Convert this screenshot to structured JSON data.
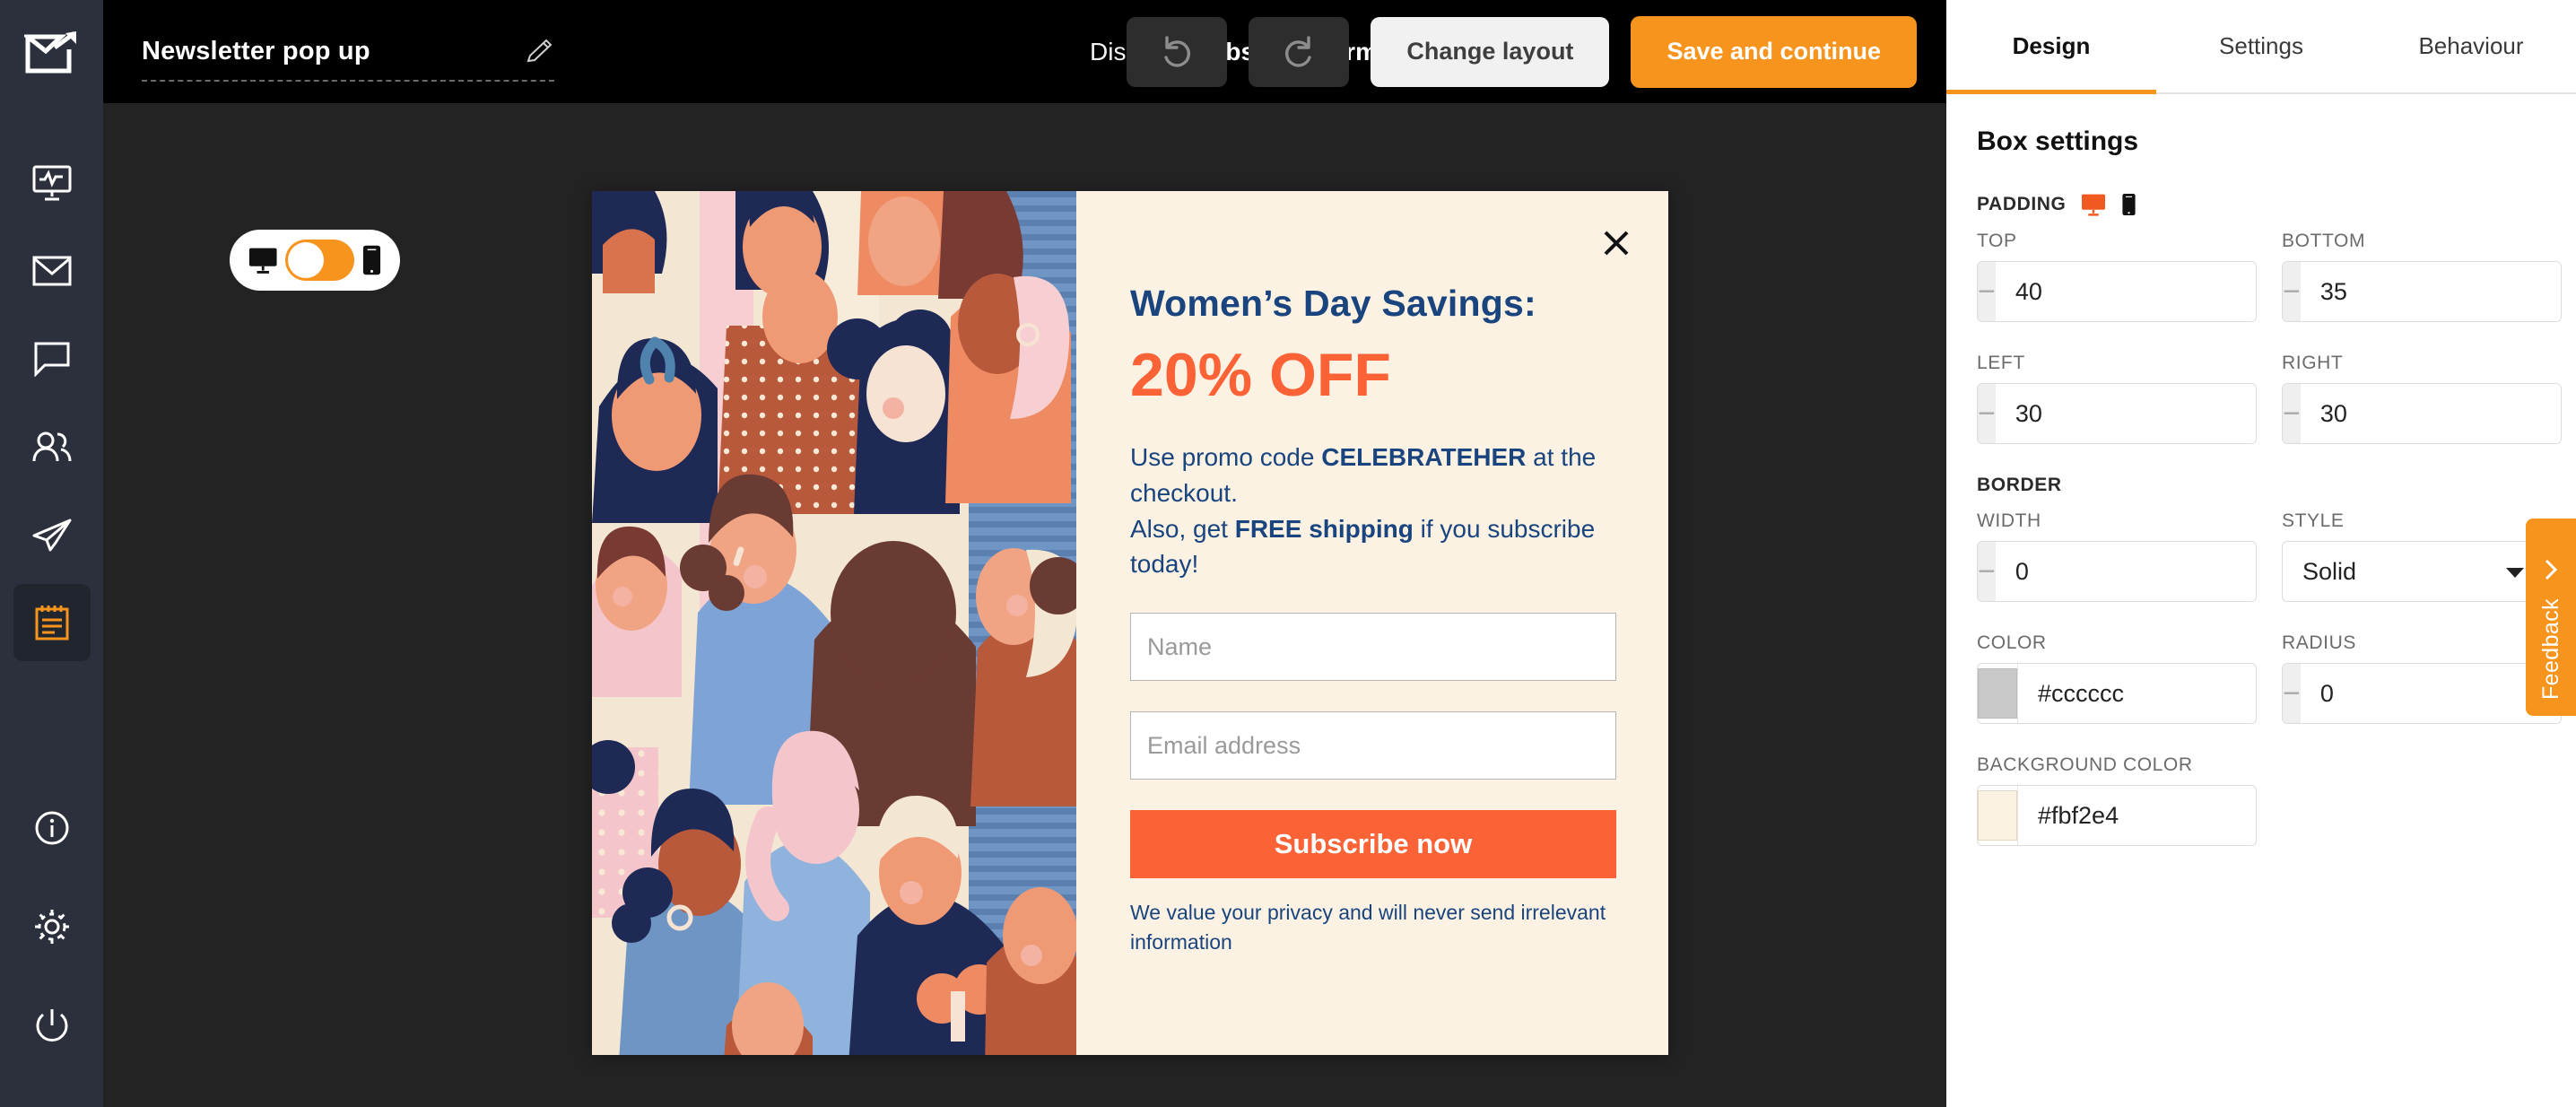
{
  "app": {
    "logo_icon": "mail-open-arrow-icon"
  },
  "topbar": {
    "doc_title": "Newsletter pop up",
    "edit_icon": "pencil-icon",
    "display_label": "Display:",
    "display_value": "Subscribe form",
    "display_caret_icon": "chevron-down-icon",
    "undo_icon": "undo-icon",
    "redo_icon": "redo-icon",
    "change_layout_label": "Change layout",
    "save_label": "Save and continue"
  },
  "sidebar": {
    "items": [
      {
        "icon": "dashboard-monitor-icon",
        "active": false
      },
      {
        "icon": "envelope-icon",
        "active": false
      },
      {
        "icon": "chat-bubble-icon",
        "active": false
      },
      {
        "icon": "contacts-group-icon",
        "active": false
      },
      {
        "icon": "paper-plane-icon",
        "active": false
      },
      {
        "icon": "form-clipboard-icon",
        "active": true
      }
    ],
    "bottom_items": [
      {
        "icon": "info-circle-icon"
      },
      {
        "icon": "gear-icon"
      },
      {
        "icon": "power-icon"
      }
    ]
  },
  "canvas": {
    "device_toggle": {
      "desktop_icon": "desktop-monitor-icon",
      "mobile_icon": "mobile-phone-icon",
      "state": "desktop"
    }
  },
  "popup": {
    "close_icon": "close-icon",
    "image_alt": "womens-day-crowd-illustration",
    "heading": "Women’s Day Savings:",
    "discount": "20% OFF",
    "body_line1_pre": "Use promo code ",
    "body_line1_code": "CELEBRATEHER",
    "body_line1_post": " at the checkout.",
    "body_line2_pre": "Also, get ",
    "body_line2_bold": "FREE shipping",
    "body_line2_post": " if you subscribe today!",
    "name_value": "",
    "name_placeholder": "Name",
    "email_value": "",
    "email_placeholder": "Email address",
    "subscribe_label": "Subscribe now",
    "privacy_note": "We value your privacy and will never send irrelevant information",
    "colors": {
      "background": "#fbf2e4",
      "heading": "#19447e",
      "accent": "#fb6236"
    }
  },
  "right_panel": {
    "tabs": [
      {
        "label": "Design",
        "active": true
      },
      {
        "label": "Settings",
        "active": false
      },
      {
        "label": "Behaviour",
        "active": false
      }
    ],
    "section_title": "Box settings",
    "padding": {
      "label": "PADDING",
      "desktop_icon": "desktop-monitor-icon",
      "mobile_icon": "mobile-phone-icon",
      "selected_device": "desktop",
      "fields": [
        {
          "label": "TOP",
          "value": "40",
          "minus": "−",
          "plus": "+"
        },
        {
          "label": "BOTTOM",
          "value": "35",
          "minus": "−",
          "plus": "+"
        },
        {
          "label": "LEFT",
          "value": "30",
          "minus": "−",
          "plus": "+"
        },
        {
          "label": "RIGHT",
          "value": "30",
          "minus": "−",
          "plus": "+"
        }
      ]
    },
    "border": {
      "label": "BORDER",
      "width_label": "WIDTH",
      "width_value": "0",
      "style_label": "STYLE",
      "style_value": "Solid",
      "style_caret_icon": "chevron-down-icon",
      "color_label": "COLOR",
      "color_value": "#cccccc",
      "color_swatch": "#c8c8c8",
      "radius_label": "RADIUS",
      "radius_value": "0",
      "minus": "−",
      "plus": "+"
    },
    "background": {
      "label": "BACKGROUND COLOR",
      "value": "#fbf2e4",
      "swatch": "#fbf2e4"
    }
  },
  "feedback": {
    "label": "Feedback",
    "chevron_icon": "chevron-right-icon"
  }
}
